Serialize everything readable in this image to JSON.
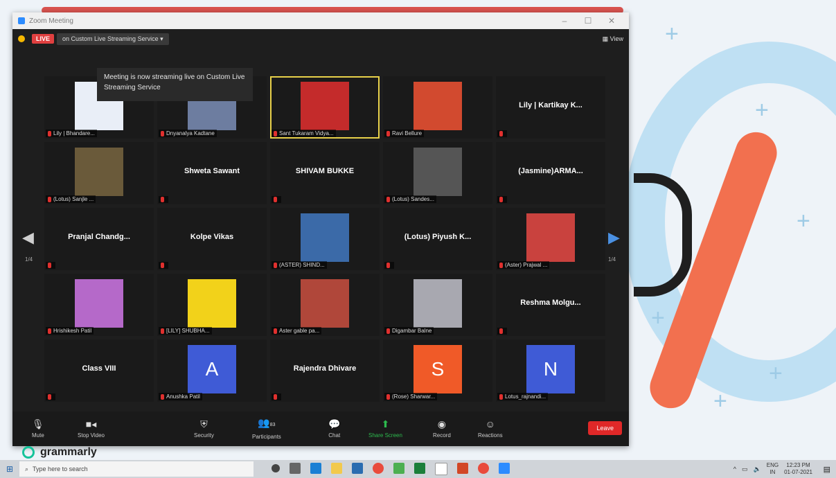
{
  "window": {
    "title": "Zoom Meeting"
  },
  "livebar": {
    "live": "LIVE",
    "service": "on Custom Live Streaming Service ▾",
    "view": "View"
  },
  "tooltip": {
    "text": "Meeting is now streaming live on Custom Live Streaming Service"
  },
  "tiles": [
    {
      "name": "Lily | Bhandare...",
      "kind": "pic",
      "color": "#e9eef7"
    },
    {
      "name": "Dnyanalya Kadtane",
      "kind": "pic",
      "color": "#6d7da0"
    },
    {
      "name": "Sant Tukaram Vidya...",
      "kind": "pic",
      "color": "#c42b2b",
      "active": true
    },
    {
      "name": "Ravi Bellure",
      "kind": "pic",
      "color": "#d24a2f"
    },
    {
      "name": "",
      "kind": "text",
      "center": "Lily | Kartikay K..."
    },
    {
      "name": "(Lotus) Sanjle ...",
      "kind": "pic",
      "color": "#6a5a3a"
    },
    {
      "name": "",
      "kind": "text",
      "center": "Shweta Sawant"
    },
    {
      "name": "",
      "kind": "text",
      "center": "SHIVAM BUKKE"
    },
    {
      "name": "(Lotus) Sandes...",
      "kind": "pic",
      "color": "#555"
    },
    {
      "name": "",
      "kind": "text",
      "center": "(Jasmine)ARMA..."
    },
    {
      "name": "",
      "kind": "text",
      "center": "Pranjal  Chandg..."
    },
    {
      "name": "",
      "kind": "text",
      "center": "Kolpe Vikas"
    },
    {
      "name": "(ASTER) SHIND...",
      "kind": "pic",
      "color": "#3b6aa8"
    },
    {
      "name": "",
      "kind": "text",
      "center": "(Lotus)  Piyush  K..."
    },
    {
      "name": "(Aster) Prajwal ...",
      "kind": "pic",
      "color": "#c9423e"
    },
    {
      "name": "Hrishikesh Patil",
      "kind": "pic",
      "color": "#b569c9"
    },
    {
      "name": "[LILY] SHUBHA...",
      "kind": "pic",
      "color": "#f2d21a"
    },
    {
      "name": "Aster gable pa...",
      "kind": "pic",
      "color": "#b0473a"
    },
    {
      "name": "Digambar Balne",
      "kind": "pic",
      "color": "#a8a8b0"
    },
    {
      "name": "",
      "kind": "text",
      "center": "Reshma  Molgu..."
    },
    {
      "name": "",
      "kind": "text",
      "center": "Class VIII"
    },
    {
      "name": "Anushka Patil",
      "kind": "avatar",
      "letter": "A",
      "color": "#3f5bd6"
    },
    {
      "name": "",
      "kind": "text",
      "center": "Rajendra Dhivare"
    },
    {
      "name": "(Rose) Sharwar...",
      "kind": "avatar",
      "letter": "S",
      "color": "#f05a28"
    },
    {
      "name": "Lotus_rajnandi...",
      "kind": "avatar",
      "letter": "N",
      "color": "#3f5bd6"
    }
  ],
  "pager": {
    "left": "1/4",
    "right": "1/4"
  },
  "toolbar": {
    "mute": "Mute",
    "stop_video": "Stop Video",
    "security": "Security",
    "participants": "Participants",
    "participants_count": "83",
    "chat": "Chat",
    "share_screen": "Share Screen",
    "record": "Record",
    "reactions": "Reactions",
    "leave": "Leave"
  },
  "grammarly": "grammarly",
  "taskbar": {
    "search_placeholder": "Type here to search",
    "lang": "ENG",
    "region": "IN",
    "time": "12:23 PM",
    "date": "01-07-2021"
  }
}
